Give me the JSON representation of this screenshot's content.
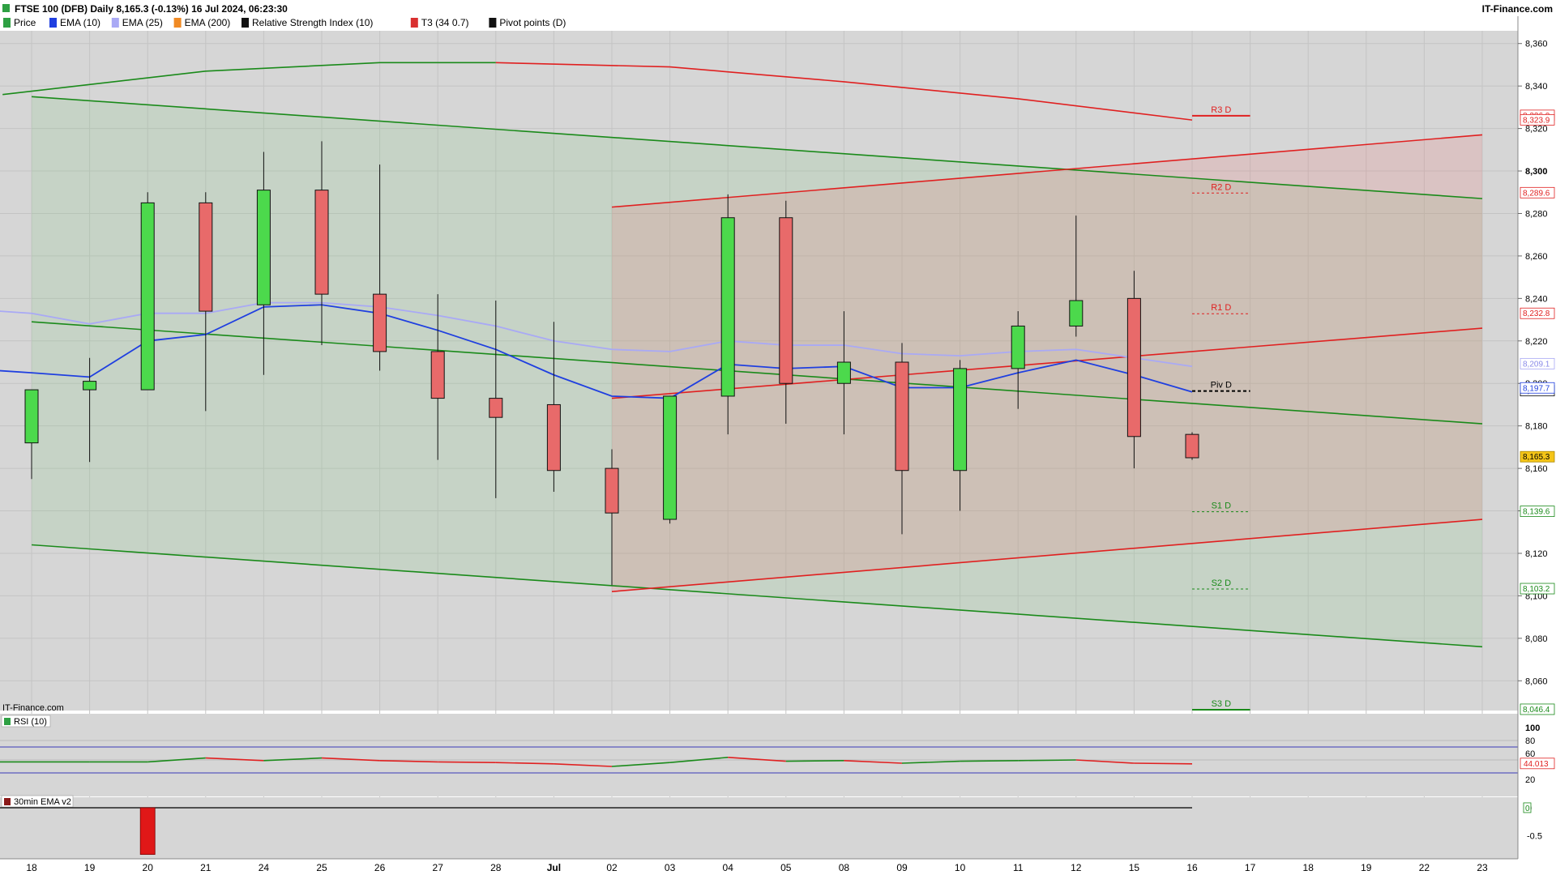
{
  "header": {
    "title": "FTSE 100 (DFB) Daily 8,165.3 (-0.13%) 16 Jul 2024, 06:23:30",
    "brand": "IT-Finance.com",
    "legend": [
      {
        "label": "Price",
        "color": "#2ea043"
      },
      {
        "label": "EMA (10)",
        "color": "#1f3fe0"
      },
      {
        "label": "EMA (25)",
        "color": "#a9a9f5"
      },
      {
        "label": "EMA (200)",
        "color": "#f08a24"
      },
      {
        "label": "Relative Strength Index (10)",
        "color": "#111111"
      },
      {
        "label": "T3 (34 0.7)",
        "color": "#d93030"
      },
      {
        "label": "Pivot points (D)",
        "color": "#111111"
      }
    ]
  },
  "colors": {
    "bull": "#4cd94c",
    "bear": "#e86a6a",
    "ema10": "#1f3fe0",
    "ema25": "#a9a9f5",
    "green_channel": "#1a8a1a",
    "red_channel": "#e02020"
  },
  "chart_data": [
    {
      "type": "candlestick",
      "title": "FTSE 100 (DFB) Daily 8,165.3 (-0.13%) 16 Jul 2024, 06:23:30",
      "watermark": "IT-Finance.com",
      "ylim": [
        8046,
        8366
      ],
      "y_ticks": [
        "8,060",
        "8,080",
        "8,100",
        "8,120",
        "8,140",
        "8,160",
        "8,180",
        "8,200",
        "8,220",
        "8,240",
        "8,260",
        "8,280",
        "8,300",
        "8,320",
        "8,340",
        "8,360"
      ],
      "x_labels": [
        "18",
        "19",
        "20",
        "21",
        "24",
        "25",
        "26",
        "27",
        "28",
        "Jul",
        "02",
        "03",
        "04",
        "05",
        "08",
        "09",
        "10",
        "11",
        "12",
        "15",
        "16",
        "17",
        "18",
        "19",
        "22",
        "23"
      ],
      "candles": [
        {
          "date": "18",
          "open": 8172,
          "high": 8194,
          "low": 8155,
          "close": 8197
        },
        {
          "date": "19",
          "open": 8197,
          "high": 8212,
          "low": 8163,
          "close": 8201
        },
        {
          "date": "20",
          "open": 8197,
          "high": 8290,
          "low": 8197,
          "close": 8285
        },
        {
          "date": "21",
          "open": 8285,
          "high": 8290,
          "low": 8187,
          "close": 8234
        },
        {
          "date": "24",
          "open": 8237,
          "high": 8309,
          "low": 8204,
          "close": 8291
        },
        {
          "date": "25",
          "open": 8291,
          "high": 8314,
          "low": 8218,
          "close": 8242
        },
        {
          "date": "26",
          "open": 8242,
          "high": 8303,
          "low": 8206,
          "close": 8215
        },
        {
          "date": "27",
          "open": 8215,
          "high": 8242,
          "low": 8164,
          "close": 8193
        },
        {
          "date": "28",
          "open": 8193,
          "high": 8239,
          "low": 8146,
          "close": 8184
        },
        {
          "date": "Jul",
          "open": 8190,
          "high": 8229,
          "low": 8149,
          "close": 8159
        },
        {
          "date": "02",
          "open": 8160,
          "high": 8169,
          "low": 8105,
          "close": 8139
        },
        {
          "date": "03",
          "open": 8136,
          "high": 8194,
          "low": 8134,
          "close": 8194
        },
        {
          "date": "04",
          "open": 8194,
          "high": 8289,
          "low": 8176,
          "close": 8278
        },
        {
          "date": "05",
          "open": 8278,
          "high": 8286,
          "low": 8181,
          "close": 8200
        },
        {
          "date": "08",
          "open": 8200,
          "high": 8234,
          "low": 8176,
          "close": 8210
        },
        {
          "date": "09",
          "open": 8210,
          "high": 8219,
          "low": 8129,
          "close": 8159
        },
        {
          "date": "10",
          "open": 8159,
          "high": 8211,
          "low": 8140,
          "close": 8207
        },
        {
          "date": "11",
          "open": 8207,
          "high": 8234,
          "low": 8188,
          "close": 8227
        },
        {
          "date": "12",
          "open": 8227,
          "high": 8279,
          "low": 8222,
          "close": 8239
        },
        {
          "date": "15",
          "open": 8240,
          "high": 8253,
          "low": 8160,
          "close": 8175
        },
        {
          "date": "16",
          "open": 8176,
          "high": 8177,
          "low": 8164,
          "close": 8165
        }
      ],
      "ema": [
        {
          "name": "EMA (10)",
          "values": [
            8205,
            8203,
            8220,
            8223,
            8236,
            8237,
            8233,
            8225,
            8216,
            8204,
            8194,
            8193,
            8209,
            8207,
            8208,
            8198,
            8198,
            8205,
            8211,
            8204,
            8196
          ]
        },
        {
          "name": "EMA (25)",
          "values": [
            8233,
            8228,
            8233,
            8233,
            8238,
            8238,
            8236,
            8232,
            8227,
            8220,
            8216,
            8215,
            8220,
            8218,
            8218,
            8214,
            8213,
            8215,
            8216,
            8212,
            8208
          ]
        }
      ],
      "pivots": [
        {
          "label": "R3 D",
          "value": 8326.0,
          "tag": "8,326.0"
        },
        {
          "label": "R2 D",
          "value": 8289.6,
          "tag": "8,289.6"
        },
        {
          "label": "R1 D",
          "value": 8232.8,
          "tag": "8,232.8"
        },
        {
          "label": "Piv D",
          "value": 8196.4,
          "tag": "8,196.4"
        },
        {
          "label": "S1 D",
          "value": 8139.6,
          "tag": "8,139.6"
        },
        {
          "label": "S2 D",
          "value": 8103.2,
          "tag": "8,103.2"
        },
        {
          "label": "S3 D",
          "value": 8046.4,
          "tag": "8,046.4"
        }
      ],
      "axis_tags": [
        {
          "value": 8323.9,
          "text": "8,323.9",
          "style": "red"
        },
        {
          "value": 8209.1,
          "text": "8,209.1",
          "style": "ema25"
        },
        {
          "value": 8197.7,
          "text": "8,197.7",
          "style": "ema10"
        },
        {
          "value": 8165.3,
          "text": "8,165.3",
          "style": "price"
        }
      ],
      "green_channel": {
        "upper": [
          {
            "x": 0,
            "y": 8335
          },
          {
            "x": 25,
            "y": 8287
          }
        ],
        "lower": [
          {
            "x": 0,
            "y": 8124
          },
          {
            "x": 25,
            "y": 8076
          }
        ],
        "mid": [
          {
            "x": 0,
            "y": 8229
          },
          {
            "x": 25,
            "y": 8181
          }
        ],
        "arc": [
          {
            "x": -0.5,
            "y": 8336
          },
          {
            "x": 3,
            "y": 8347
          },
          {
            "x": 6,
            "y": 8351
          },
          {
            "x": 8,
            "y": 8351
          },
          {
            "x": 11,
            "y": 8349
          },
          {
            "x": 14,
            "y": 8342
          },
          {
            "x": 17,
            "y": 8334
          },
          {
            "x": 20,
            "y": 8324
          }
        ]
      },
      "red_channel": {
        "upper": [
          {
            "x": 10,
            "y": 8283
          },
          {
            "x": 25,
            "y": 8317
          }
        ],
        "lower": [
          {
            "x": 10,
            "y": 8102
          },
          {
            "x": 25,
            "y": 8136
          }
        ],
        "mid": [
          {
            "x": 10,
            "y": 8193
          },
          {
            "x": 25,
            "y": 8226
          }
        ]
      }
    },
    {
      "type": "line",
      "title": "RSI (10)",
      "ylim": [
        0,
        100
      ],
      "y_ticks": [
        "100",
        "80",
        "60",
        "20"
      ],
      "levels": [
        70,
        30
      ],
      "last_value_tag": "44.013",
      "values": [
        47,
        47,
        47,
        53,
        49,
        53,
        49,
        47,
        46,
        44,
        40,
        46,
        54,
        48,
        49,
        45,
        48,
        49,
        50,
        45,
        44
      ]
    },
    {
      "type": "bar",
      "title": "30min EMA v2",
      "ylim": [
        -0.85,
        0.1
      ],
      "y_ticks": [
        "0",
        "-0.5"
      ],
      "zero_tag": "0",
      "values": [
        0,
        0,
        -0.83,
        0,
        0,
        0,
        0,
        0,
        0,
        0,
        0,
        0,
        0,
        0,
        0,
        0,
        0,
        0,
        0,
        0,
        0
      ]
    }
  ]
}
